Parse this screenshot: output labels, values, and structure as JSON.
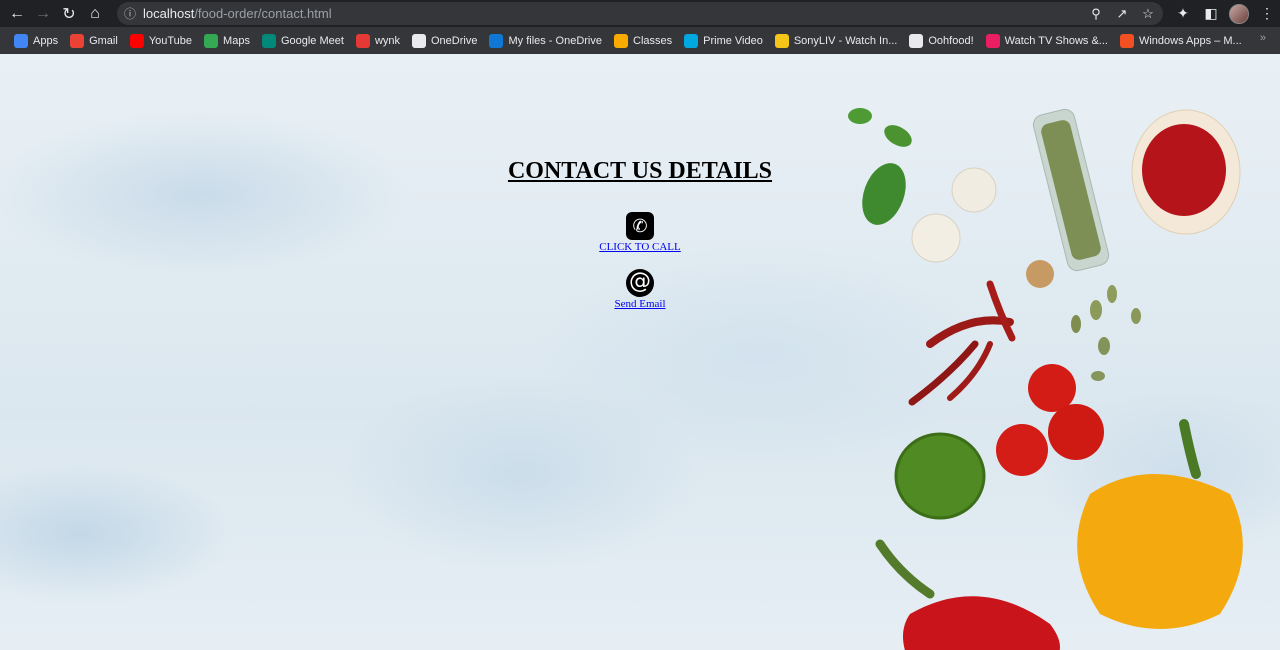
{
  "browser": {
    "url_host": "localhost",
    "url_path": "/food-order/contact.html",
    "bookmarks": [
      {
        "label": "Apps",
        "color": "#4285f4"
      },
      {
        "label": "Gmail",
        "color": "#ea4335"
      },
      {
        "label": "YouTube",
        "color": "#ff0000"
      },
      {
        "label": "Maps",
        "color": "#34a853"
      },
      {
        "label": "Google Meet",
        "color": "#00897b"
      },
      {
        "label": "wynk",
        "color": "#e53935"
      },
      {
        "label": "OneDrive",
        "color": "#e8eaed"
      },
      {
        "label": "My files - OneDrive",
        "color": "#0f78d4"
      },
      {
        "label": "Classes",
        "color": "#f9ab00"
      },
      {
        "label": "Prime Video",
        "color": "#00a8e1"
      },
      {
        "label": "SonyLIV - Watch In...",
        "color": "#f5c518"
      },
      {
        "label": "Oohfood!",
        "color": "#e8eaed"
      },
      {
        "label": "Watch TV Shows &...",
        "color": "#e91e63"
      },
      {
        "label": "Windows Apps – M...",
        "color": "#f25022"
      }
    ],
    "more": "»"
  },
  "page": {
    "heading": "CONTACT US DETAILS",
    "call_link": "CLICK TO CALL",
    "email_link": "Send Email",
    "phone_icon": "phone-icon",
    "email_icon": "at-sign-icon"
  }
}
